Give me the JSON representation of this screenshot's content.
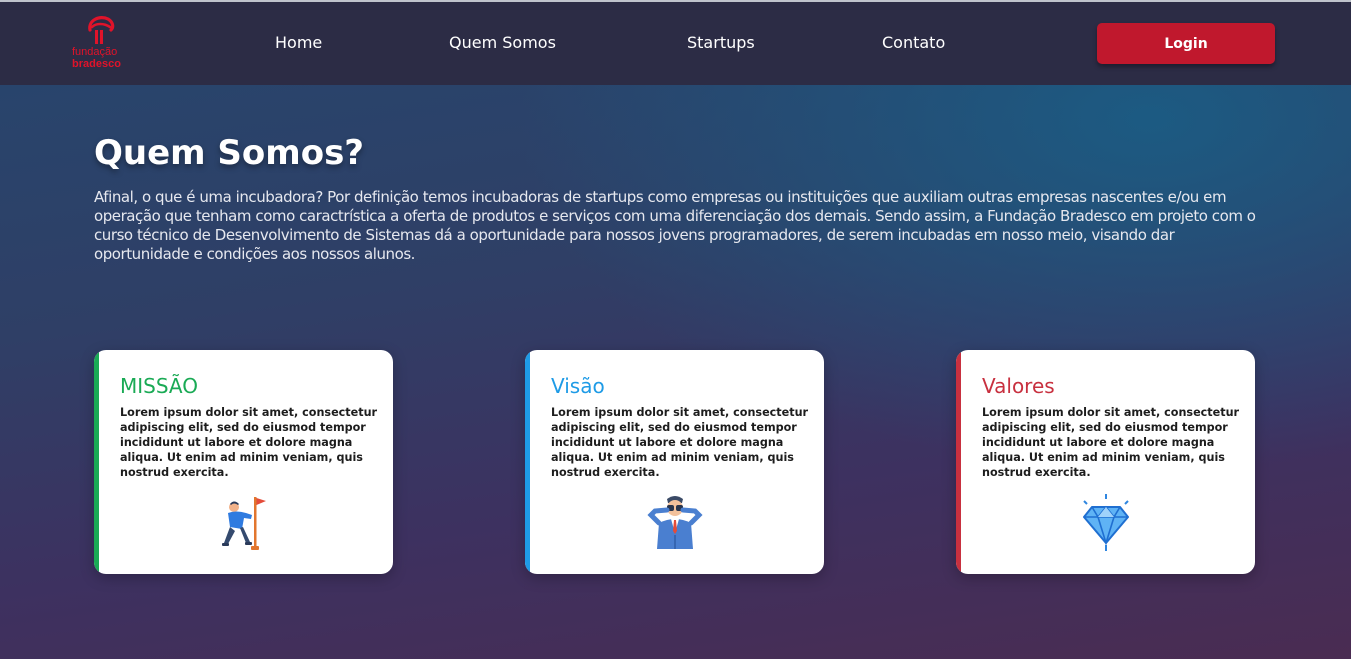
{
  "brand": {
    "line1": "fundação",
    "line2": "bradesco",
    "color": "#e0132a"
  },
  "nav": {
    "links": [
      "Home",
      "Quem Somos",
      "Startups",
      "Contato"
    ],
    "login_label": "Login"
  },
  "hero": {
    "title": "Quem Somos?",
    "text": "Afinal, o que é uma incubadora? Por definição temos incubadoras de startups como empresas ou instituições que auxiliam outras empresas nascentes e/ou em operação que tenham como caractrística a oferta de produtos e serviços com uma diferenciação dos demais. Sendo assim, a Fundação Bradesco em projeto com o curso técnico de Desenvolvimento de Sistemas dá a oportunidade para nossos jovens programadores, de serem incubadas em nosso meio, visando dar oportunidade e condições aos nossos alunos."
  },
  "cards": [
    {
      "title": "MISSÃO",
      "text": "Lorem ipsum dolor sit amet, consectetur adipiscing elit, sed do eiusmod tempor incididunt ut labore et dolore magna aliqua. Ut enim ad minim veniam, quis nostrud exercita.",
      "accent": "#1aaa55",
      "icon": "person-with-flag-icon"
    },
    {
      "title": "Visão",
      "text": "Lorem ipsum dolor sit amet, consectetur adipiscing elit, sed do eiusmod tempor incididunt ut labore et dolore magna aliqua. Ut enim ad minim veniam, quis nostrud exercita.",
      "accent": "#1e9be6",
      "icon": "man-with-binoculars-icon"
    },
    {
      "title": "Valores",
      "text": "Lorem ipsum dolor sit amet, consectetur adipiscing elit, sed do eiusmod tempor incididunt ut labore et dolore magna aliqua. Ut enim ad minim veniam, quis nostrud exercita.",
      "accent": "#c8303f",
      "icon": "diamond-icon"
    }
  ]
}
